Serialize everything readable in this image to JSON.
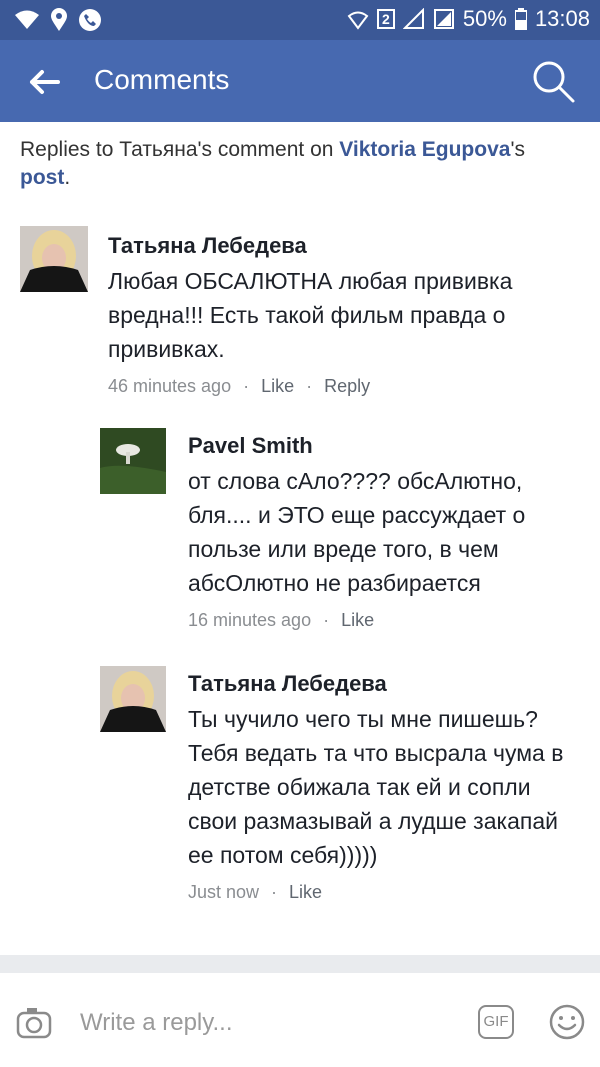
{
  "status_bar": {
    "battery": "50%",
    "time": "13:08",
    "sim_badge": "2"
  },
  "header": {
    "title": "Comments"
  },
  "context": {
    "prefix": "Replies to Татьяна's comment on ",
    "author_link": "Viktoria Egupova",
    "mid": "'s ",
    "post_link": "post",
    "suffix": "."
  },
  "comments": [
    {
      "author": "Татьяна Лебедева",
      "text": "Любая ОБСАЛЮТНА любая прививка вредна!!! Есть такой фильм правда о прививках.",
      "time": "46 minutes ago",
      "like": "Like",
      "reply": "Reply"
    },
    {
      "author": "Pavel Smith",
      "text": "от слова сАло???? обсАлютно, бля.... и ЭТО еще рассуждает о пользе или вреде того, в чем абсОлютно не разбирается",
      "time": "16 minutes ago",
      "like": "Like"
    },
    {
      "author": "Татьяна Лебедева",
      "text": "Ты чучило чего ты мне пишешь? Тебя ведать та что высрала чума в детстве обижала так ей и сопли свои размазывай а лудше закапай ее потом себя)))))",
      "time": "Just now",
      "like": "Like"
    }
  ],
  "composer": {
    "placeholder": "Write a reply...",
    "gif_label": "GIF"
  },
  "colors": {
    "status_bar": "#3b5896",
    "app_bar": "#4769b0",
    "link": "#3b5896",
    "meta": "#8a8d91"
  }
}
